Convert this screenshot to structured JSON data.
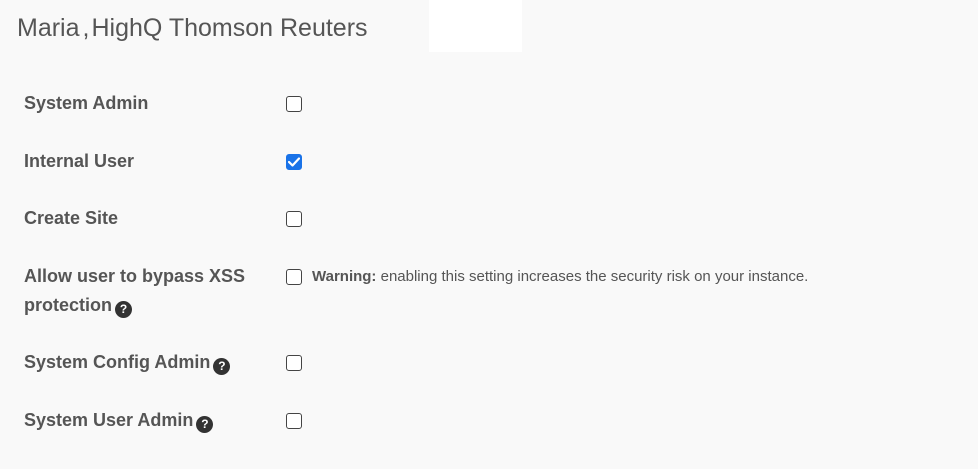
{
  "header": {
    "name": "Maria",
    "separator": ",",
    "organization": "HighQ Thomson Reuters"
  },
  "permissions": [
    {
      "label": "System Admin",
      "checked": false,
      "help": false
    },
    {
      "label": "Internal User",
      "checked": true,
      "help": false
    },
    {
      "label": "Create Site",
      "checked": false,
      "help": false
    },
    {
      "label_line1": "Allow user to bypass XSS",
      "label_line2": "protection",
      "checked": false,
      "help": true,
      "warning_label": "Warning:",
      "warning_text": "enabling this setting increases the security risk on your instance."
    },
    {
      "label": "System Config Admin",
      "checked": false,
      "help": true
    },
    {
      "label": "System User Admin",
      "checked": false,
      "help": true
    }
  ],
  "icons": {
    "help": "question-circle-icon",
    "help_glyph": "?",
    "checkmark": "checkmark-icon"
  },
  "colors": {
    "accent": "#1a73e8",
    "text": "#555555",
    "background": "#f9f9f9"
  }
}
